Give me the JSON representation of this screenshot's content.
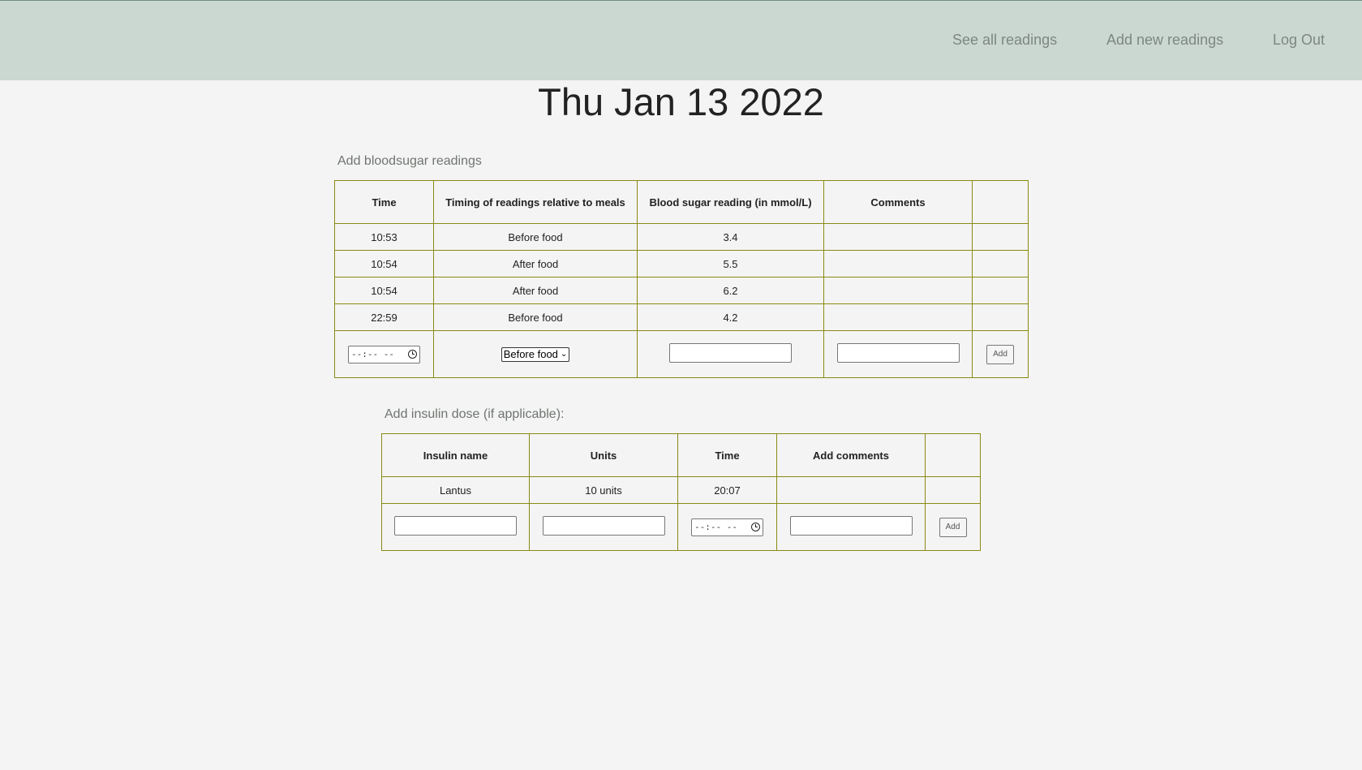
{
  "nav": {
    "see_all": "See all readings",
    "add_new": "Add new readings",
    "logout": "Log Out"
  },
  "date_title": "Thu Jan 13 2022",
  "bloodsugar": {
    "label": "Add bloodsugar readings",
    "headers": [
      "Time",
      "Timing of readings relative to meals",
      "Blood sugar reading (in mmol/L)",
      "Comments",
      ""
    ],
    "rows": [
      {
        "time": "10:53",
        "timing": "Before food",
        "reading": "3.4",
        "comments": ""
      },
      {
        "time": "10:54",
        "timing": "After food",
        "reading": "5.5",
        "comments": ""
      },
      {
        "time": "10:54",
        "timing": "After food",
        "reading": "6.2",
        "comments": ""
      },
      {
        "time": "22:59",
        "timing": "Before food",
        "reading": "4.2",
        "comments": ""
      }
    ],
    "input": {
      "time_placeholder": "--:-- --",
      "timing_selected": "Before food",
      "add_label": "Add"
    }
  },
  "insulin": {
    "label": "Add insulin dose (if applicable):",
    "headers": [
      "Insulin name",
      "Units",
      "Time",
      "Add comments",
      ""
    ],
    "rows": [
      {
        "name": "Lantus",
        "units": "10 units",
        "time": "20:07",
        "comments": ""
      }
    ],
    "input": {
      "time_placeholder": "--:-- --",
      "add_label": "Add"
    }
  },
  "colors": {
    "navbar": "#cbd8d1",
    "table_border": "#8a8a14",
    "background": "#f4f4f4"
  }
}
